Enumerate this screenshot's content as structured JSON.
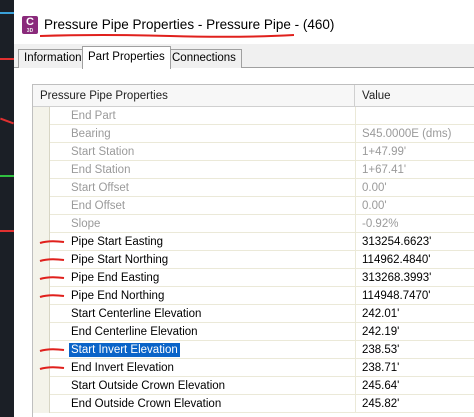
{
  "window": {
    "title": "Pressure Pipe Properties - Pressure Pipe - (460)",
    "app_icon_letter": "C",
    "app_icon_sub": "3D"
  },
  "tabs": [
    {
      "label": "Information",
      "active": false
    },
    {
      "label": "Part Properties",
      "active": true
    },
    {
      "label": "Connections",
      "active": false
    }
  ],
  "grid": {
    "header_name": "Pressure Pipe Properties",
    "header_value": "Value",
    "rows": [
      {
        "name": "End Part",
        "value": "",
        "disabled": true
      },
      {
        "name": "Bearing",
        "value": "S45.0000E (dms)",
        "disabled": true
      },
      {
        "name": "Start Station",
        "value": "1+47.99'",
        "disabled": true
      },
      {
        "name": "End Station",
        "value": "1+67.41'",
        "disabled": true
      },
      {
        "name": "Start Offset",
        "value": "0.00'",
        "disabled": true
      },
      {
        "name": "End Offset",
        "value": "0.00'",
        "disabled": true
      },
      {
        "name": "Slope",
        "value": "-0.92%",
        "disabled": true
      },
      {
        "name": "Pipe Start Easting",
        "value": "313254.6623'",
        "disabled": false,
        "marked": true
      },
      {
        "name": "Pipe Start Northing",
        "value": "114962.4840'",
        "disabled": false,
        "marked": true
      },
      {
        "name": "Pipe End Easting",
        "value": "313268.3993'",
        "disabled": false,
        "marked": true
      },
      {
        "name": "Pipe End Northing",
        "value": "114948.7470'",
        "disabled": false,
        "marked": true
      },
      {
        "name": "Start Centerline Elevation",
        "value": "242.01'",
        "disabled": false
      },
      {
        "name": "End Centerline Elevation",
        "value": "242.19'",
        "disabled": false
      },
      {
        "name": "Start Invert Elevation",
        "value": "238.53'",
        "disabled": false,
        "selected": true,
        "marked": true
      },
      {
        "name": "End Invert Elevation",
        "value": "238.71'",
        "disabled": false,
        "marked": true
      },
      {
        "name": "Start Outside Crown Elevation",
        "value": "245.64'",
        "disabled": false
      },
      {
        "name": "End Outside Crown Elevation",
        "value": "245.82'",
        "disabled": false
      }
    ]
  },
  "colors": {
    "annotation_red": "#e0201c",
    "selection_blue": "#0a64c8",
    "app_icon": "#8a2a7b"
  }
}
